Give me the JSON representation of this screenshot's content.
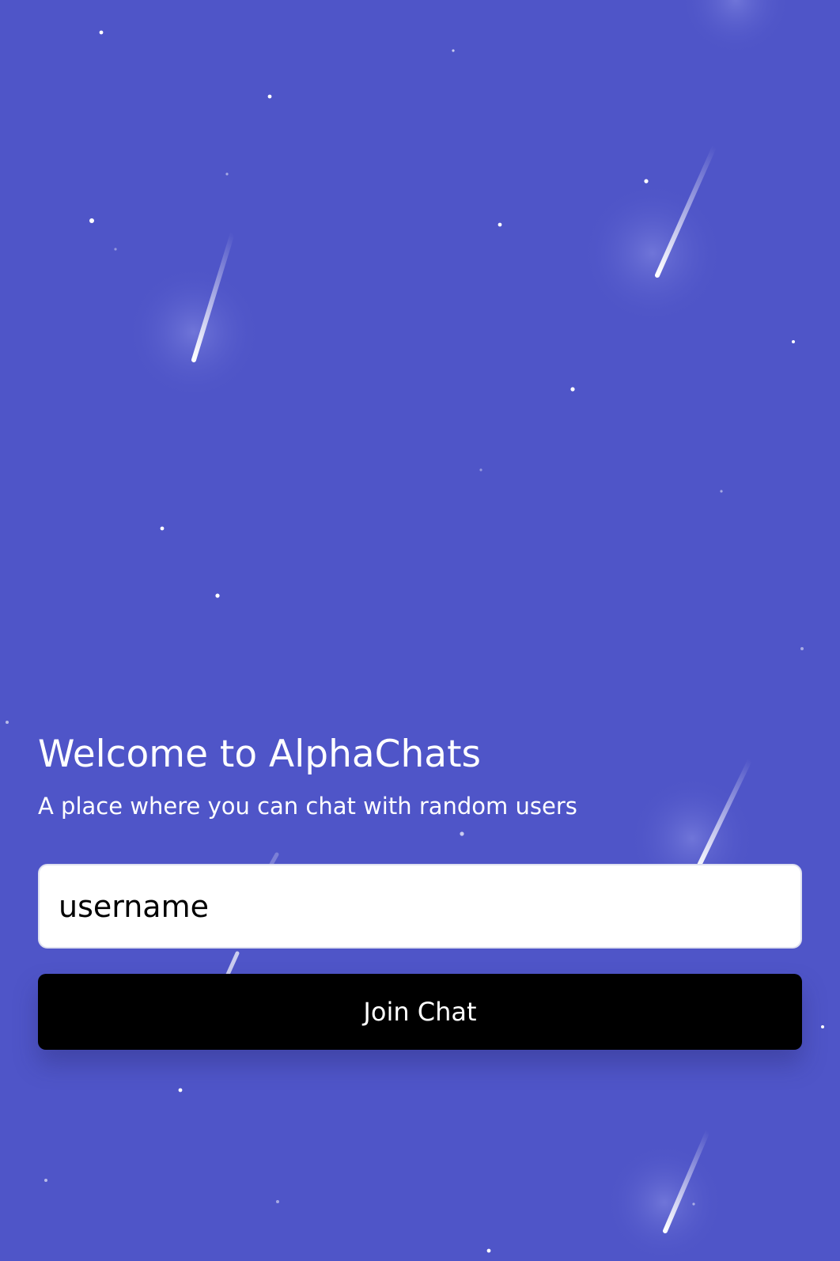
{
  "theme": {
    "background": "#4f55c8",
    "button_background": "#000000",
    "button_text": "#ffffff",
    "input_background": "#ffffff"
  },
  "welcome": {
    "title": "Welcome to AlphaChats",
    "subtitle": "A place where you can chat with random users"
  },
  "form": {
    "username_placeholder": "username",
    "username_value": "",
    "join_label": "Join Chat"
  }
}
